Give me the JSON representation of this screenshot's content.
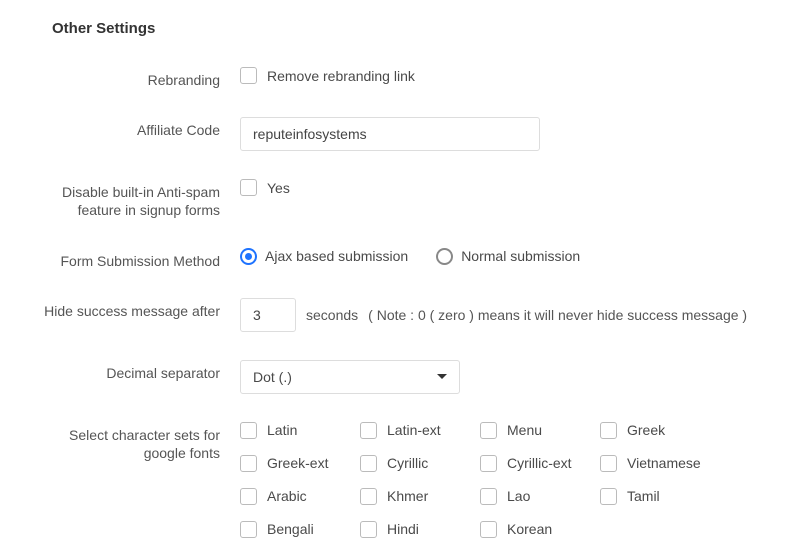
{
  "section_title": "Other Settings",
  "rebranding": {
    "label": "Rebranding",
    "option": "Remove rebranding link"
  },
  "affiliate": {
    "label": "Affiliate Code",
    "value": "reputeinfosystems"
  },
  "antispam": {
    "label": "Disable built-in Anti-spam feature in signup forms",
    "option": "Yes"
  },
  "submission": {
    "label": "Form Submission Method",
    "options": [
      "Ajax based submission",
      "Normal submission"
    ],
    "selected": 0
  },
  "hide_msg": {
    "label": "Hide success message after",
    "value": "3",
    "unit": "seconds",
    "note": "( Note : 0 ( zero ) means it will never hide success message )"
  },
  "decimal": {
    "label": "Decimal separator",
    "selected": "Dot (.)"
  },
  "charsets": {
    "label": "Select character sets for google fonts",
    "options": [
      "Latin",
      "Latin-ext",
      "Menu",
      "Greek",
      "Greek-ext",
      "Cyrillic",
      "Cyrillic-ext",
      "Vietnamese",
      "Arabic",
      "Khmer",
      "Lao",
      "Tamil",
      "Bengali",
      "Hindi",
      "Korean"
    ]
  }
}
